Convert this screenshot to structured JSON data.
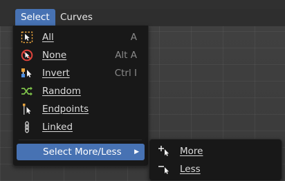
{
  "header": {
    "tabs": [
      {
        "label": "Select"
      },
      {
        "label": "Curves"
      }
    ]
  },
  "select_menu": {
    "items": [
      {
        "label": "All",
        "shortcut": "A",
        "icon": "select-all-icon"
      },
      {
        "label": "None",
        "shortcut": "Alt A",
        "icon": "select-none-icon"
      },
      {
        "label": "Invert",
        "shortcut": "Ctrl I",
        "icon": "select-invert-icon"
      },
      {
        "label": "Random",
        "shortcut": "",
        "icon": "random-icon"
      },
      {
        "label": "Endpoints",
        "shortcut": "",
        "icon": "endpoints-icon"
      },
      {
        "label": "Linked",
        "shortcut": "",
        "icon": "linked-icon"
      }
    ],
    "more_less": {
      "label": "Select More/Less"
    }
  },
  "submenu": {
    "items": [
      {
        "label": "More",
        "icon": "select-more-icon"
      },
      {
        "label": "Less",
        "icon": "select-less-icon"
      }
    ]
  },
  "colors": {
    "accent": "#4772b3",
    "menu_bg": "#181818",
    "shortcut_text": "#8a8a8a",
    "header_bg": "#303030"
  }
}
